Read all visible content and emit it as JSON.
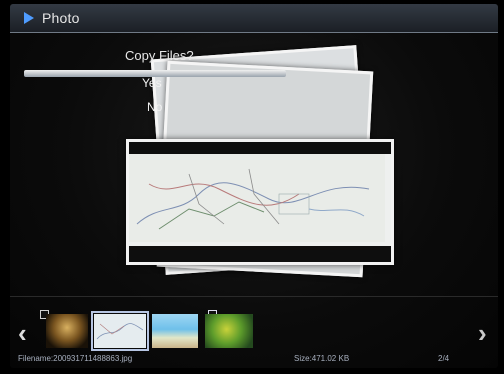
{
  "header": {
    "title": "Photo",
    "icon": "play-arrow-icon",
    "accent": "#4f9cff"
  },
  "dialog": {
    "title": "Copy Files?",
    "options": [
      "Yes",
      "No"
    ],
    "selected": "Yes"
  },
  "thumbnails": [
    {
      "name": "thumbnail-1",
      "marked": true
    },
    {
      "name": "thumbnail-2",
      "selected": true
    },
    {
      "name": "thumbnail-3"
    },
    {
      "name": "thumbnail-4",
      "marked": true
    }
  ],
  "footer": {
    "filename": "Filename:200931711488863.jpg",
    "size": "Size:471.02 KB",
    "page": "2/4"
  },
  "nav": {
    "prev_icon": "chevron-left-icon",
    "next_icon": "chevron-right-icon"
  }
}
